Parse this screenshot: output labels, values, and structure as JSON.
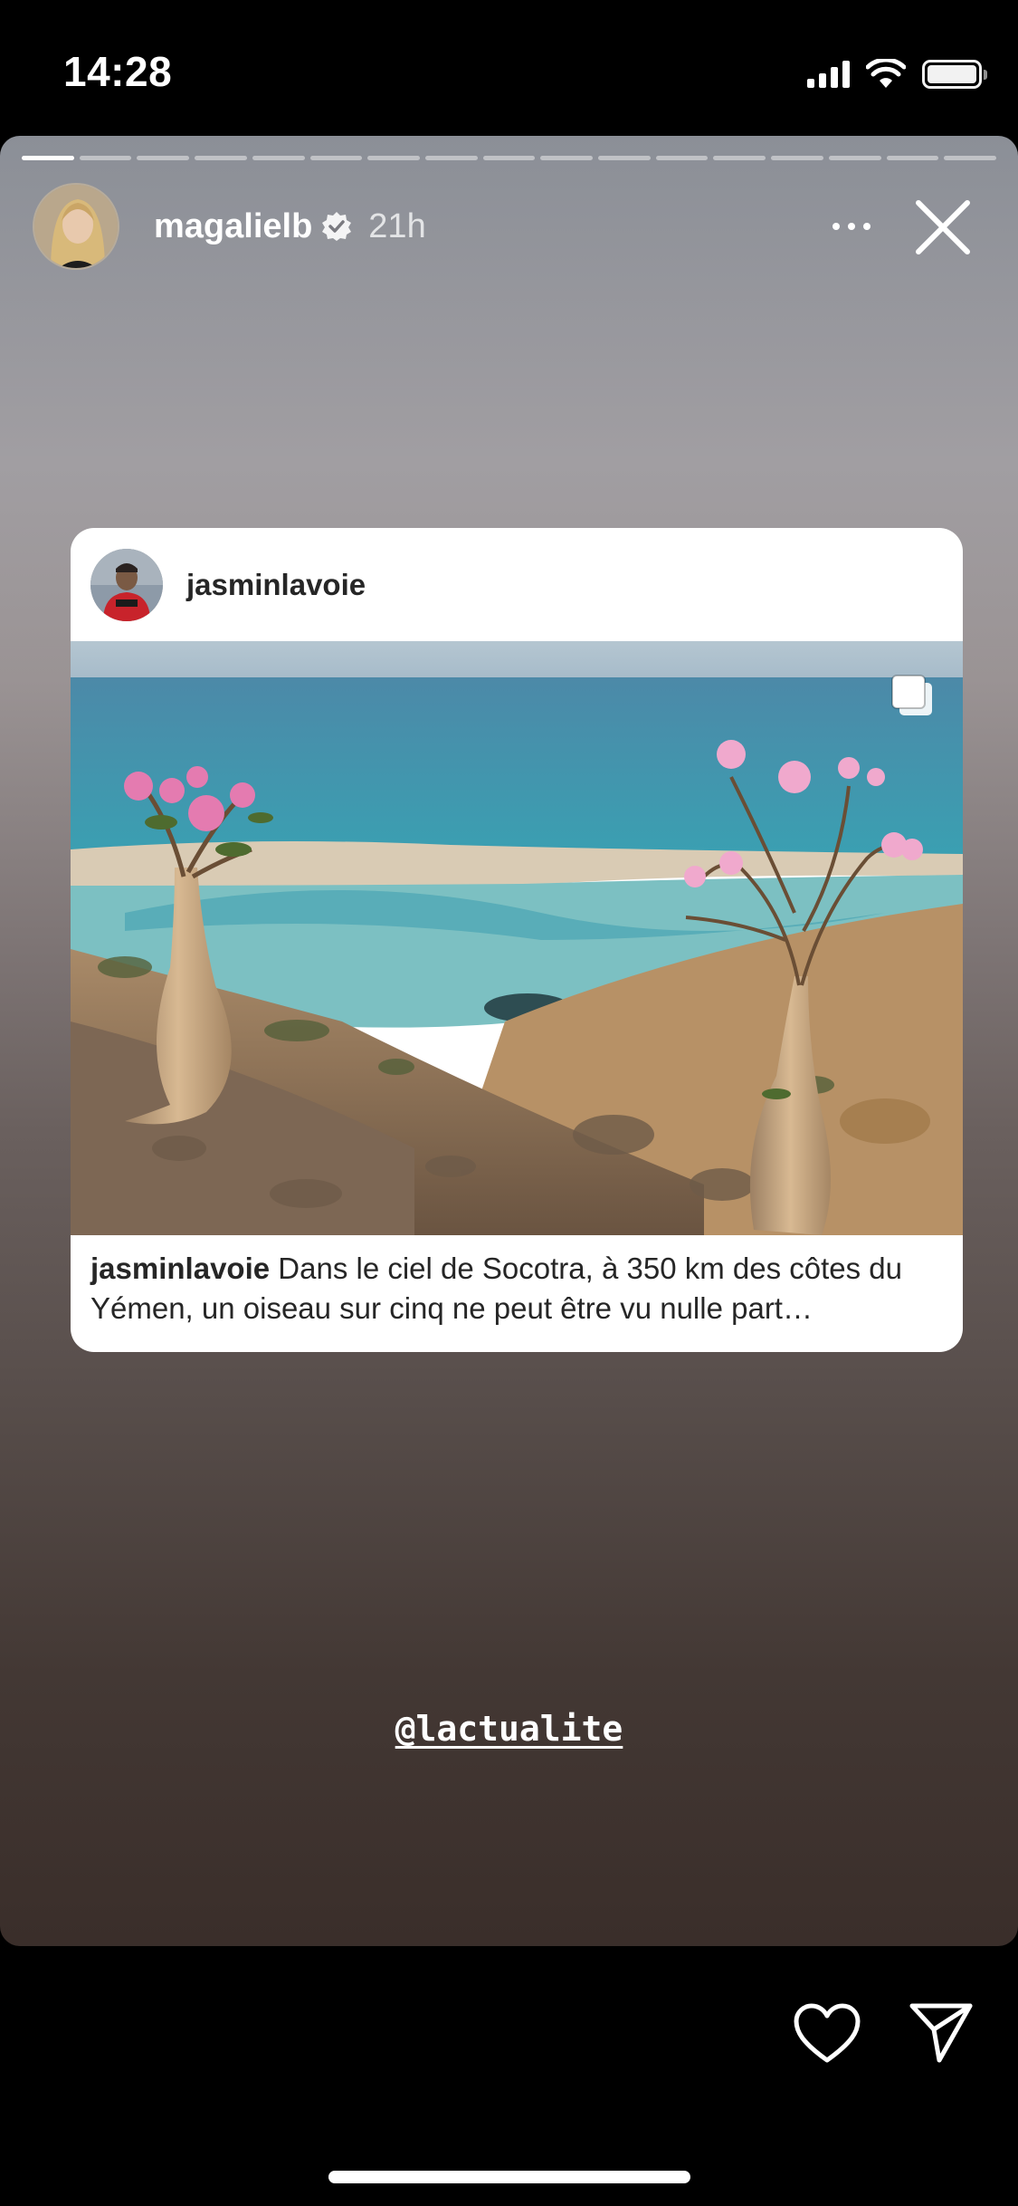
{
  "status_bar": {
    "time": "14:28"
  },
  "story": {
    "segments_total": 17,
    "segments_viewed": 1,
    "username": "magalielb",
    "verified": true,
    "time_ago": "21h",
    "more_icon": "more-horizontal-icon",
    "close_icon": "close-icon"
  },
  "shared_post": {
    "username": "jasminlavoie",
    "caption_username": "jasminlavoie",
    "caption_text": "Dans le ciel de Socotra, à 350 km des côtes du Yémen, un oiseau sur cinq ne peut être vu nulle part…",
    "carousel_icon": "carousel-icon"
  },
  "mention": "@lactualite",
  "actions": {
    "like_icon": "heart-icon",
    "share_icon": "send-icon"
  }
}
